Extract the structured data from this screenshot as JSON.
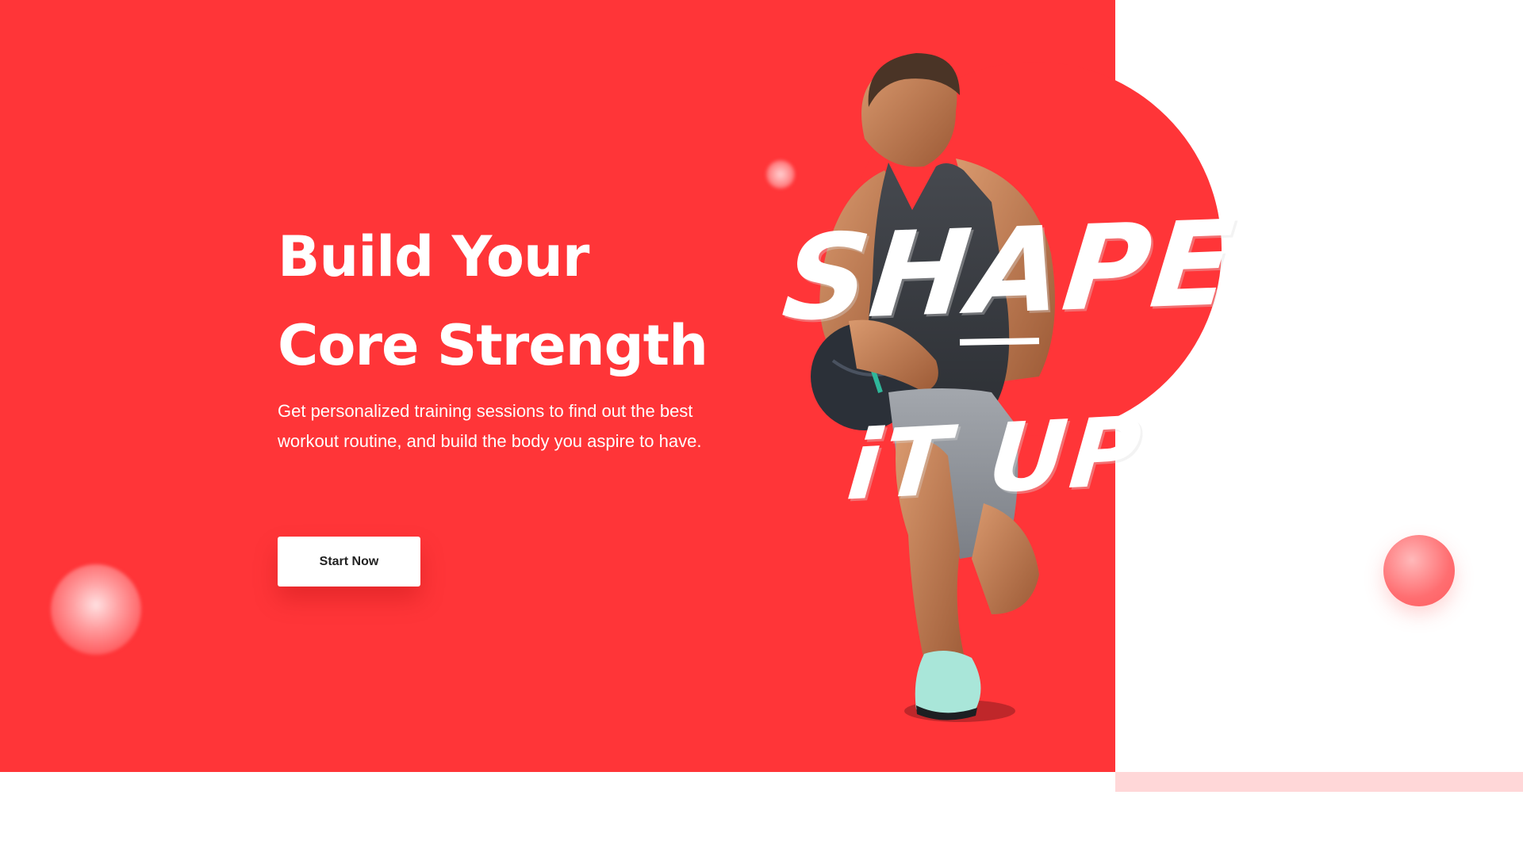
{
  "hero": {
    "title_line1": "Build Your",
    "title_line2": "Core Strength",
    "description": "Get personalized training sessions to find out the best workout routine, and build the body you aspire to have.",
    "cta_label": "Start Now"
  },
  "image": {
    "slogan_line1": "SHAPE",
    "slogan_line2": "iT UP"
  },
  "colors": {
    "accent": "#ff3538",
    "strip": "#ffd7d8",
    "background": "#ffffff"
  }
}
